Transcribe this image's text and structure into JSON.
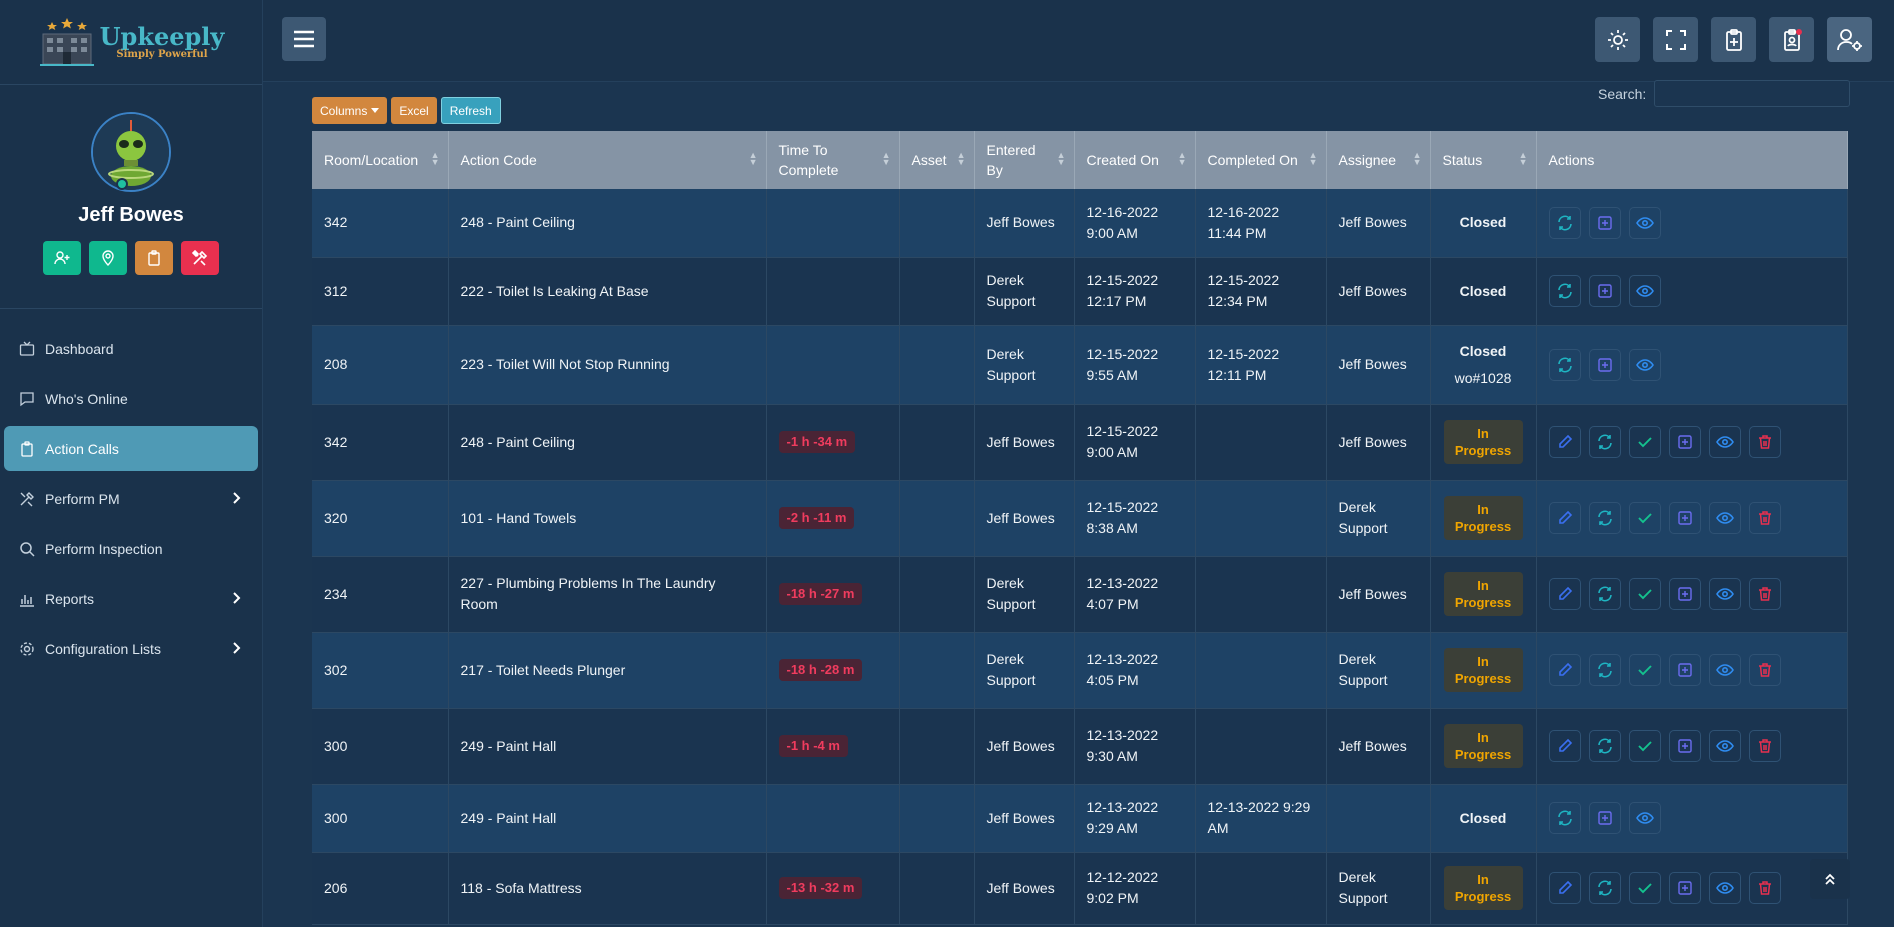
{
  "brand": {
    "name": "Upkeeply",
    "tagline": "Simply Powerful"
  },
  "user": {
    "name": "Jeff Bowes"
  },
  "quick_actions": [
    {
      "icon": "add-user-icon",
      "color": "#0fb88e"
    },
    {
      "icon": "location-pin-icon",
      "color": "#0fb88e"
    },
    {
      "icon": "clipboard-icon",
      "color": "#d2873e"
    },
    {
      "icon": "tools-icon",
      "color": "#e8304f"
    }
  ],
  "nav": [
    {
      "label": "Dashboard",
      "icon": "tv-icon",
      "chevron": false,
      "active": false
    },
    {
      "label": "Who's Online",
      "icon": "chat-icon",
      "chevron": false,
      "active": false
    },
    {
      "label": "Action Calls",
      "icon": "clipboard-icon",
      "chevron": false,
      "active": true
    },
    {
      "label": "Perform PM",
      "icon": "tools-icon",
      "chevron": true,
      "active": false
    },
    {
      "label": "Perform Inspection",
      "icon": "search-icon",
      "chevron": false,
      "active": false
    },
    {
      "label": "Reports",
      "icon": "bar-chart-icon",
      "chevron": true,
      "active": false
    },
    {
      "label": "Configuration Lists",
      "icon": "gear-icon",
      "chevron": true,
      "active": false
    }
  ],
  "toolbar": {
    "columns_label": "Columns",
    "excel_label": "Excel",
    "refresh_label": "Refresh",
    "search_label": "Search:"
  },
  "columns": [
    "Room/Location",
    "Action Code",
    "Time To Complete",
    "Asset",
    "Entered By",
    "Created On",
    "Completed On",
    "Assignee",
    "Status",
    "Actions"
  ],
  "rows": [
    {
      "room": "342",
      "code": "248 - Paint Ceiling",
      "time": "",
      "asset": "",
      "entered": "Jeff Bowes",
      "created": "12-16-2022 9:00 AM",
      "completed": "12-16-2022 11:44 PM",
      "assignee": "Jeff Bowes",
      "status": "Closed",
      "wo": ""
    },
    {
      "room": "312",
      "code": "222 - Toilet Is Leaking At Base",
      "time": "",
      "asset": "",
      "entered": "Derek Support",
      "created": "12-15-2022 12:17 PM",
      "completed": "12-15-2022 12:34 PM",
      "assignee": "Jeff Bowes",
      "status": "Closed",
      "wo": ""
    },
    {
      "room": "208",
      "code": "223 - Toilet Will Not Stop Running",
      "time": "",
      "asset": "",
      "entered": "Derek Support",
      "created": "12-15-2022 9:55 AM",
      "completed": "12-15-2022 12:11 PM",
      "assignee": "Jeff Bowes",
      "status": "Closed",
      "wo": "wo#1028"
    },
    {
      "room": "342",
      "code": "248 - Paint Ceiling",
      "time": "-1 h -34 m",
      "asset": "",
      "entered": "Jeff Bowes",
      "created": "12-15-2022 9:00 AM",
      "completed": "",
      "assignee": "Jeff Bowes",
      "status": "In Progress",
      "wo": ""
    },
    {
      "room": "320",
      "code": "101 - Hand Towels",
      "time": "-2 h -11 m",
      "asset": "",
      "entered": "Jeff Bowes",
      "created": "12-15-2022 8:38 AM",
      "completed": "",
      "assignee": "Derek Support",
      "status": "In Progress",
      "wo": ""
    },
    {
      "room": "234",
      "code": "227 - Plumbing Problems In The Laundry Room",
      "time": "-18 h -27 m",
      "asset": "",
      "entered": "Derek Support",
      "created": "12-13-2022 4:07 PM",
      "completed": "",
      "assignee": "Jeff Bowes",
      "status": "In Progress",
      "wo": ""
    },
    {
      "room": "302",
      "code": "217 - Toilet Needs Plunger",
      "time": "-18 h -28 m",
      "asset": "",
      "entered": "Derek Support",
      "created": "12-13-2022 4:05 PM",
      "completed": "",
      "assignee": "Derek Support",
      "status": "In Progress",
      "wo": ""
    },
    {
      "room": "300",
      "code": "249 - Paint Hall",
      "time": "-1 h -4 m",
      "asset": "",
      "entered": "Jeff Bowes",
      "created": "12-13-2022 9:30 AM",
      "completed": "",
      "assignee": "Jeff Bowes",
      "status": "In Progress",
      "wo": ""
    },
    {
      "room": "300",
      "code": "249 - Paint Hall",
      "time": "",
      "asset": "",
      "entered": "Jeff Bowes",
      "created": "12-13-2022 9:29 AM",
      "completed": "12-13-2022 9:29 AM",
      "assignee": "",
      "status": "Closed",
      "wo": ""
    },
    {
      "room": "206",
      "code": "118 - Sofa Mattress",
      "time": "-13 h -32 m",
      "asset": "",
      "entered": "Jeff Bowes",
      "created": "12-12-2022 9:02 PM",
      "completed": "",
      "assignee": "Derek Support",
      "status": "In Progress",
      "wo": ""
    }
  ],
  "colors": {
    "accent": "#4f9ab5",
    "danger": "#f03c5e",
    "warning": "#f0a500",
    "success": "#0fb88e"
  }
}
